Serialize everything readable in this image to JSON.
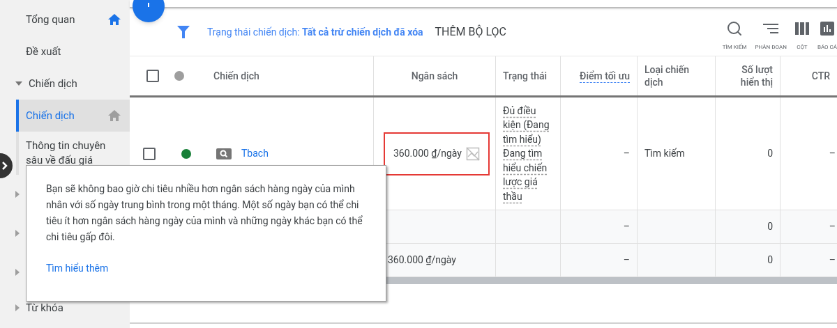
{
  "sidebar": {
    "items": [
      {
        "label": "Tổng quan",
        "kind": "home-page"
      },
      {
        "label": "Đề xuất",
        "kind": "page"
      },
      {
        "label": "Chiến dịch",
        "kind": "group",
        "expanded": true,
        "children": [
          {
            "label": "Chiến dịch",
            "selected": true
          },
          {
            "label": "Thông tin chuyên sâu về đấu giá",
            "selected": false
          }
        ]
      },
      {
        "kind": "group",
        "expanded": false
      },
      {
        "kind": "group",
        "expanded": false
      },
      {
        "kind": "group",
        "expanded": false
      },
      {
        "label": "Từ khóa",
        "kind": "group",
        "expanded": false
      }
    ]
  },
  "toolbar": {
    "filter": "Trạng thái chiến dịch: **Tất cả trừ chiến dịch đã xóa**",
    "add_filter": "THÊM BỘ LỌC",
    "tools": [
      {
        "label": "TÌM KIẾM",
        "kind": "search"
      },
      {
        "label": "PHÂN ĐOẠN",
        "kind": "segment"
      },
      {
        "label": "CỘT",
        "kind": "columns"
      },
      {
        "label": "BÁO CÁ",
        "kind": "reports"
      }
    ]
  },
  "table": {
    "header": {
      "checked": false,
      "color": "#9e9e9e"
    },
    "columns": [
      {
        "label": "Chiến dịch",
        "definition": false
      },
      {
        "label": "Ngân sách",
        "definition": false
      },
      {
        "label": "Trạng thái",
        "definition": false
      },
      {
        "label": "Điểm tối ưu",
        "definition": true
      },
      {
        "label": "Loại chiến dịch",
        "definition": false
      },
      {
        "label": "Số lượt hiển thị",
        "definition": false
      },
      {
        "label": "CTR",
        "definition": false
      }
    ],
    "rows": [
      {
        "kind": "campaign",
        "checked": false,
        "color": "#188038",
        "name": "Tbach",
        "budget": "360.000 ₫/ngày",
        "highlighted": true,
        "status": [
          "Đủ điều kiện (Đang tìm hiểu)",
          "Đang tìm hiểu chiến lược giá thầu"
        ],
        "optimization": "–",
        "type": "Tìm kiếm",
        "impressions": "0",
        "ctr": "–"
      },
      {
        "kind": "total",
        "optimization": "–",
        "impressions": "0",
        "ctr": "–"
      },
      {
        "kind": "total",
        "budget": "360.000 ₫/ngày",
        "optimization": "–",
        "impressions": "0",
        "ctr": "–"
      }
    ]
  },
  "tooltip": {
    "text": "Bạn sẽ không bao giờ chi tiêu nhiều hơn ngân sách hàng ngày của mình nhân với số ngày trung bình trong một tháng. Một số ngày bạn có thể chi tiêu ít hơn ngân sách hàng ngày của mình và những ngày khác bạn có thể chi tiêu gấp đôi.",
    "link": "Tìm hiểu thêm"
  }
}
